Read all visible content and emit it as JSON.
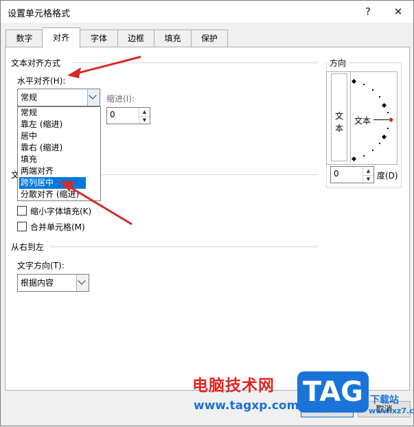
{
  "window": {
    "title": "设置单元格格式",
    "help_glyph": "?",
    "close_glyph": "✕"
  },
  "tabs": [
    {
      "label": "数字"
    },
    {
      "label": "对齐"
    },
    {
      "label": "字体"
    },
    {
      "label": "边框"
    },
    {
      "label": "填充"
    },
    {
      "label": "保护"
    }
  ],
  "active_tab": "对齐",
  "text_alignment": {
    "group_title": "文本对齐方式",
    "horizontal_label": "水平对齐(H):",
    "horizontal_value": "常规",
    "indent_label": "缩进(I):",
    "indent_value": "0",
    "horizontal_options": [
      "常规",
      "靠左 (缩进)",
      "居中",
      "靠右 (缩进)",
      "填充",
      "两端对齐",
      "跨列居中",
      "分散对齐 (缩进)"
    ],
    "selected_option": "跨列居中"
  },
  "text_control": {
    "group_title_fragment": "文",
    "shrink_label": "缩小字体填充(K)",
    "merge_label": "合并单元格(M)",
    "shrink_checked": false,
    "merge_checked": false
  },
  "rtl": {
    "group_title": "从右到左",
    "direction_label": "文字方向(T):",
    "direction_value": "根据内容"
  },
  "orientation": {
    "group_title": "方向",
    "vertical_text": "文本",
    "horizontal_text": "文本",
    "degrees_value": "0",
    "degrees_label": "度(D)"
  },
  "buttons": {
    "ok": "确定",
    "cancel": "取消"
  },
  "watermark": {
    "text": "电脑技术网",
    "url": "www.tagxp.com",
    "tag": "TAG",
    "site_fragment": "下载站",
    "site_url_fragment": "www.xz7.com"
  },
  "colors": {
    "accent": "#0078d7",
    "arrow_red": "#d42a2a"
  }
}
